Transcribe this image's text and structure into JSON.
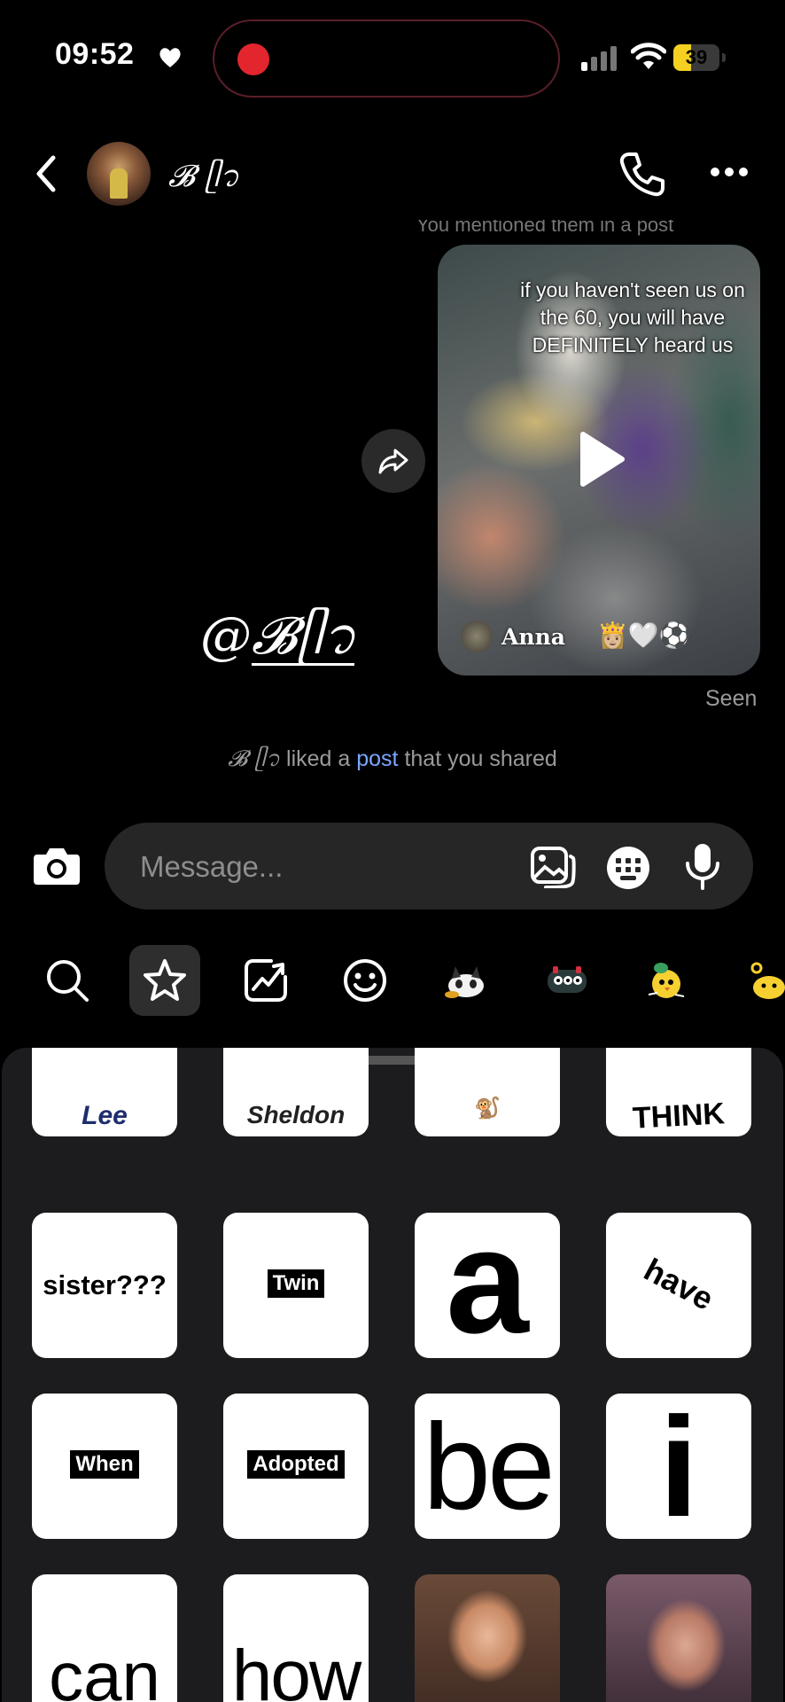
{
  "status_bar": {
    "time": "09:52",
    "battery_level": "39",
    "battery_fraction": 0.39,
    "accent_battery": "#f5d020",
    "recording_color": "#e3262e"
  },
  "header": {
    "contact_name": "𝓑 ᥫ᭡",
    "back_icon": "chevron-left-icon",
    "call_icon": "phone-icon",
    "more_icon": "more-horizontal-icon"
  },
  "chat": {
    "reply_preview_cut": "You mentioned them in a post",
    "video": {
      "overlay_text": "if you haven't seen us on the 60, you will have DEFINITELY heard us",
      "author": "Anna",
      "author_emojis": "👸🏼🤍⚽"
    },
    "mention": "@𝓑ᥫ᭡",
    "seen_label": "Seen",
    "activity": {
      "name": "𝓑 ᥫ᭡",
      "prefix": " liked a ",
      "link": "post",
      "suffix": " that you shared"
    }
  },
  "composer": {
    "placeholder": "Message..."
  },
  "tray": {
    "tabs": [
      "search-icon",
      "star-icon",
      "trending-icon",
      "smiley-icon"
    ],
    "active_tab": "star-icon"
  },
  "stickers": {
    "row0": [
      "Lee",
      "Sheldon",
      "",
      "THINK"
    ],
    "row1": [
      "sister???",
      "Twin",
      "a",
      "have"
    ],
    "row2": [
      "When",
      "Adopted",
      "be",
      "i"
    ],
    "row3": [
      "can",
      "how",
      "",
      ""
    ]
  }
}
